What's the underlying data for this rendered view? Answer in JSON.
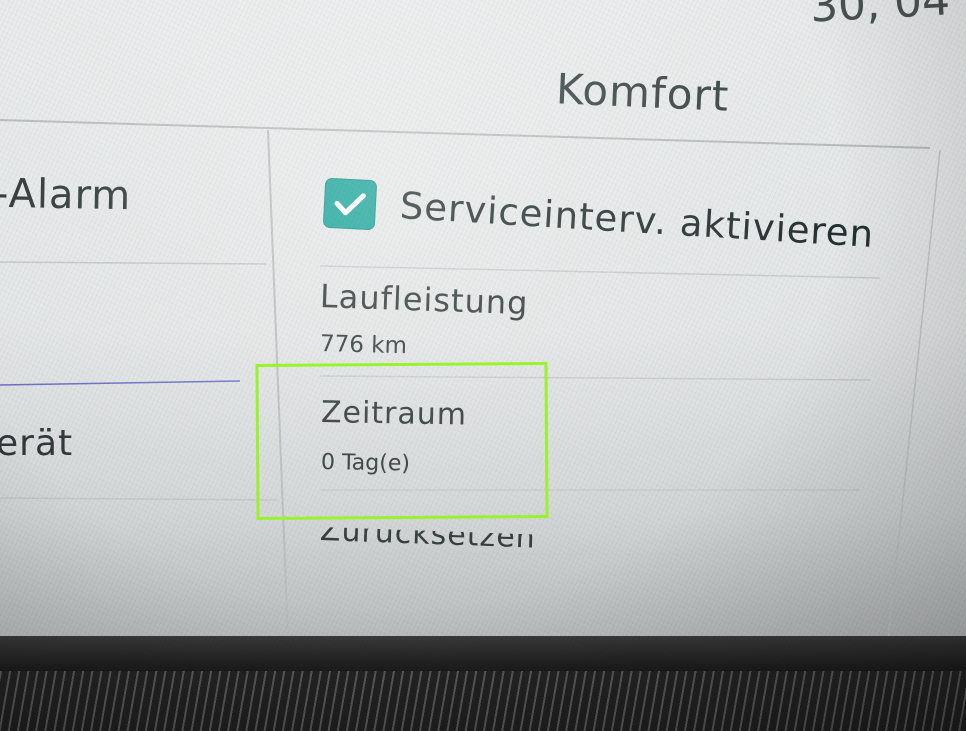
{
  "status_bar": {
    "clock_partial": "30, 04"
  },
  "header": {
    "title": "Komfort"
  },
  "left_column": {
    "items": [
      {
        "label": "-Alarm"
      },
      {
        "label": "erät"
      }
    ]
  },
  "right_column": {
    "service_interval": {
      "label": "Serviceinterv. aktivieren",
      "checked": true
    },
    "mileage": {
      "label": "Laufleistung",
      "value": "776 km"
    },
    "period": {
      "label": "Zeitraum",
      "value": "0 Tag(e)"
    },
    "reset": {
      "label": "Zurücksetzen"
    }
  },
  "colors": {
    "checkbox": "#1aa59a",
    "highlight": "#9af22d",
    "text": "#2f3838"
  },
  "icons": {
    "checkbox_icon": "checkmark-icon"
  }
}
